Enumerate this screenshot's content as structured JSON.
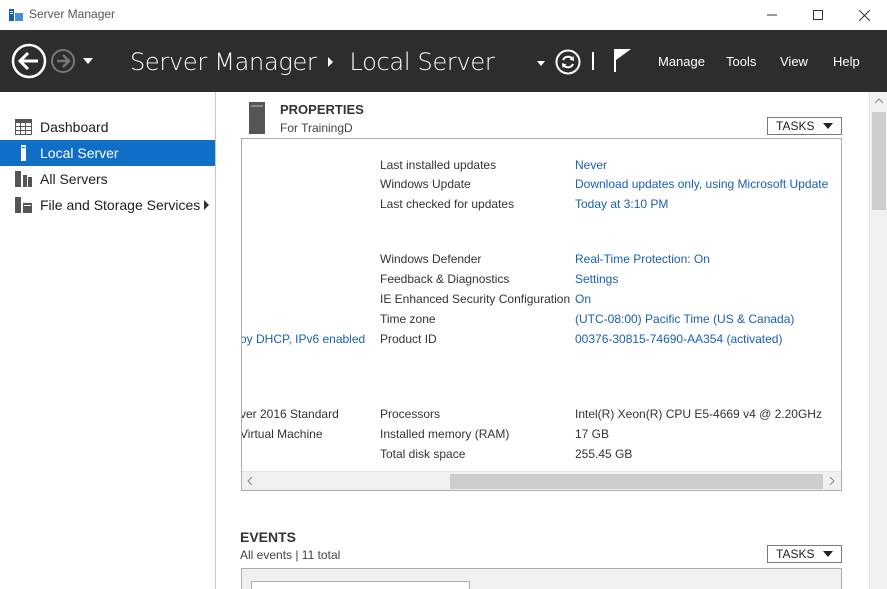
{
  "window": {
    "title": "Server Manager",
    "controls": [
      "minimize",
      "maximize",
      "close"
    ]
  },
  "header": {
    "breadcrumb": [
      "Server Manager",
      "Local Server"
    ],
    "menu": {
      "manage": "Manage",
      "tools": "Tools",
      "view": "View",
      "help": "Help"
    }
  },
  "sidebar": {
    "items": [
      {
        "label": "Dashboard",
        "icon": "dashboard-icon",
        "active": false
      },
      {
        "label": "Local Server",
        "icon": "local-server-icon",
        "active": true
      },
      {
        "label": "All Servers",
        "icon": "all-servers-icon",
        "active": false
      },
      {
        "label": "File and Storage Services",
        "icon": "storage-icon",
        "active": false,
        "has_submenu": true
      }
    ]
  },
  "properties": {
    "title": "PROPERTIES",
    "subtitle": "For TrainingD",
    "tasks_label": "TASKS",
    "rows": [
      {
        "label": "Last installed updates",
        "value": "Never",
        "link": true
      },
      {
        "label": "Windows Update",
        "value": "Download updates only, using Microsoft Update",
        "link": true
      },
      {
        "label": "Last checked for updates",
        "value": "Today at 3:10 PM",
        "link": true
      },
      {
        "label": "Windows Defender",
        "value": "Real-Time Protection: On",
        "link": true
      },
      {
        "label": "Feedback & Diagnostics",
        "value": "Settings",
        "link": true
      },
      {
        "label": "IE Enhanced Security Configuration",
        "value": "On",
        "link": true
      },
      {
        "label": "Time zone",
        "value": "(UTC-08:00) Pacific Time (US & Canada)",
        "link": true
      },
      {
        "label": "Product ID",
        "value": "00376-30815-74690-AA354 (activated)",
        "link": true
      },
      {
        "label": "Processors",
        "value": "Intel(R) Xeon(R) CPU E5-4669 v4 @ 2.20GHz",
        "link": false
      },
      {
        "label": "Installed memory (RAM)",
        "value": "17 GB",
        "link": false
      },
      {
        "label": "Total disk space",
        "value": "255.45 GB",
        "link": false
      }
    ],
    "left_fragments": {
      "network": "oy DHCP, IPv6 enabled",
      "os": "ver 2016 Standard",
      "hardware": "Virtual Machine"
    }
  },
  "events": {
    "title": "EVENTS",
    "subtitle": "All events | 11 total",
    "tasks_label": "TASKS"
  },
  "colors": {
    "header_bg": "#2d2d30",
    "active_item_bg": "#0f6fc6",
    "link": "#1a5fb4"
  }
}
